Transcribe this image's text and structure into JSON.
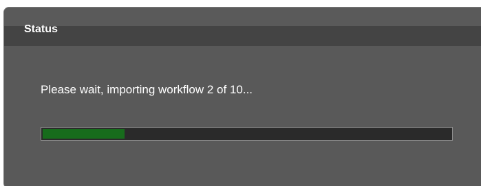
{
  "dialog": {
    "title": "Status",
    "message": "Please wait, importing workflow 2 of 10...",
    "progress": {
      "fraction": 0.2,
      "fill_color": "#176c1c",
      "track_color": "#2a2a2a"
    }
  }
}
